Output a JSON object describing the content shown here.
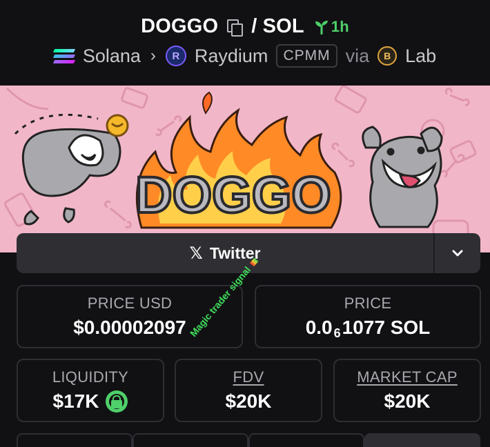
{
  "header": {
    "token_symbol": "DOGGO",
    "separator": "/",
    "quote_symbol": "SOL",
    "age": "1h",
    "chain": "Solana",
    "dex": "Raydium",
    "pool_type": "CPMM",
    "via_text": "via",
    "launchpad": "Lab"
  },
  "banner": {
    "logo_text": "DOGGO"
  },
  "social": {
    "twitter_label": "Twitter"
  },
  "stats": {
    "price_usd_label": "PRICE USD",
    "price_usd_value": "$0.00002097",
    "price_label": "PRICE",
    "price_prefix": "0.0",
    "price_subscript": "6",
    "price_suffix": "1077 SOL",
    "liquidity_label": "LIQUIDITY",
    "liquidity_value": "$17K",
    "fdv_label": "FDV",
    "fdv_value": "$20K",
    "market_cap_label": "MARKET CAP",
    "market_cap_value": "$20K"
  },
  "watermark": "Magic trader signal",
  "colors": {
    "background": "#111114",
    "card_border": "#2e2e34",
    "accent_green": "#4fd06a",
    "banner_pink": "#f2b6c9"
  },
  "icons": [
    "copy-icon",
    "sprout-icon",
    "solana-icon",
    "chevron-right-icon",
    "raydium-icon",
    "lab-icon",
    "x-logo-icon",
    "chevron-down-icon",
    "lock-icon"
  ]
}
